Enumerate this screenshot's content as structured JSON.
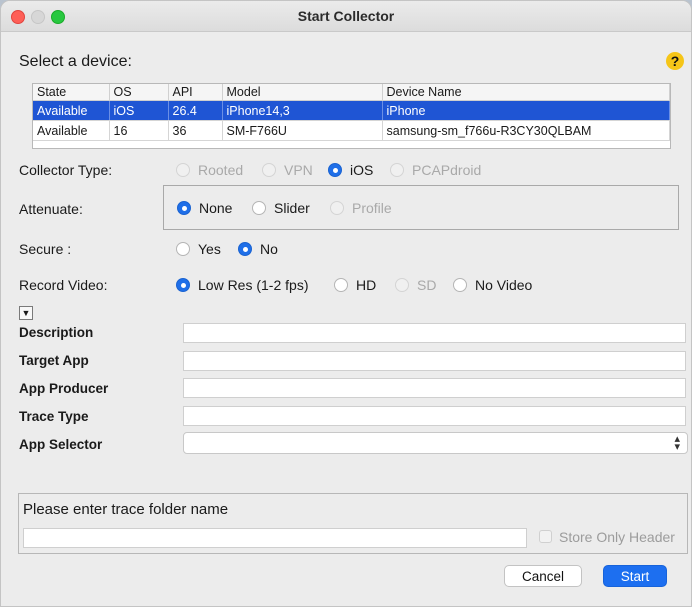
{
  "window": {
    "title": "Start Collector"
  },
  "device_section": {
    "heading": "Select a device:",
    "help_icon": "?"
  },
  "devices": {
    "columns": [
      "State",
      "OS",
      "API",
      "Model",
      "Device Name"
    ],
    "rows": [
      [
        "Available",
        "iOS",
        "26.4",
        "iPhone14,3",
        "iPhone"
      ],
      [
        "Available",
        "16",
        "36",
        "SM-F766U",
        "samsung-sm_f766u-R3CY30QLBAM"
      ]
    ],
    "selected_row": 0
  },
  "collector_type": {
    "label": "Collector Type:",
    "options": [
      "Rooted",
      "VPN",
      "iOS",
      "PCAPdroid"
    ],
    "selected": "iOS"
  },
  "attenuate": {
    "label": "Attenuate:",
    "options": [
      "None",
      "Slider",
      "Profile"
    ],
    "selected": "None"
  },
  "secure": {
    "label": "Secure :",
    "options": [
      "Yes",
      "No"
    ],
    "selected": "No"
  },
  "record_video": {
    "label": "Record Video:",
    "options": [
      "Low Res (1-2 fps)",
      "HD",
      "SD",
      "No Video"
    ],
    "selected": "Low Res (1-2 fps)"
  },
  "fields": {
    "description": {
      "label": "Description",
      "value": ""
    },
    "target_app": {
      "label": "Target App",
      "value": ""
    },
    "app_producer": {
      "label": "App Producer",
      "value": ""
    },
    "trace_type": {
      "label": "Trace Type",
      "value": ""
    },
    "app_selector": {
      "label": "App Selector",
      "value": ""
    }
  },
  "trace_folder": {
    "prompt": "Please enter trace folder name",
    "value": "",
    "store_only_header_label": "Store Only Header",
    "store_only_header_checked": false
  },
  "buttons": {
    "cancel": "Cancel",
    "start": "Start"
  },
  "colors": {
    "selection": "#1f55d4",
    "accent": "#1d6ff0",
    "help": "#f5c518"
  }
}
